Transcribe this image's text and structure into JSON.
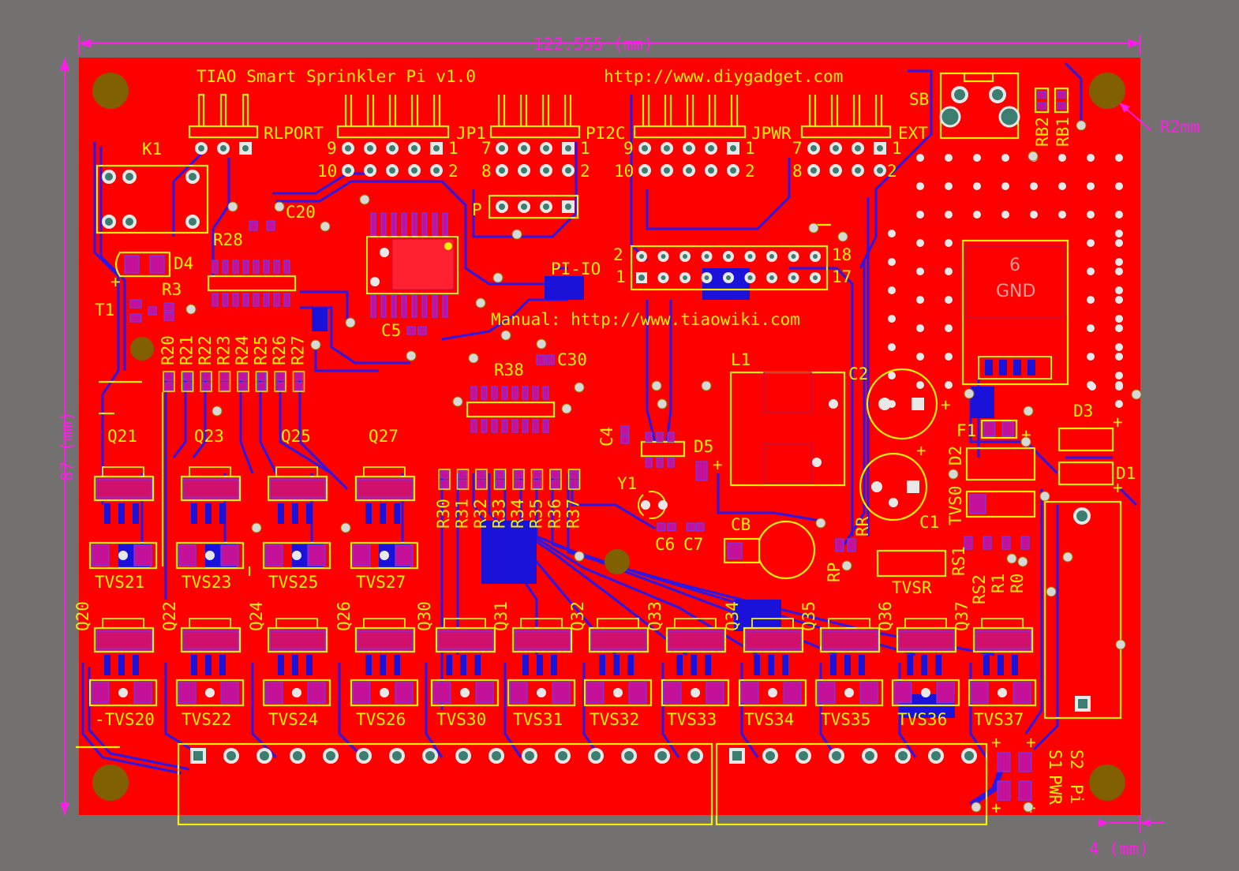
{
  "board": {
    "title": "TIAO Smart Sprinkler Pi v1.0",
    "url": "http://www.diygadget.com",
    "manual": "Manual: http://www.tiaowiki.com"
  },
  "dimensions": {
    "width_label": "122.555 (mm)",
    "height_label": "87 (mm)",
    "margin_label": "4 (mm)",
    "hole_label": "R2mm"
  },
  "connectors": {
    "rlport": "RLPORT",
    "jp1": "JP1",
    "pi2c": "PI2C",
    "jpwr": "JPWR",
    "ext": "EXT",
    "sb": "SB",
    "k1": "K1",
    "p": "P",
    "pi_io": "PI-IO",
    "pin_labels": {
      "jp1_left_top": "9",
      "jp1_right_top": "1",
      "jp1_left_bot": "10",
      "jp1_right_bot": "2",
      "pi2c_left_top": "7",
      "pi2c_right_top": "1",
      "pi2c_left_bot": "8",
      "pi2c_right_bot": "2",
      "jpwr_left_top": "9",
      "jpwr_right_top": "1",
      "jpwr_left_bot": "10",
      "jpwr_right_bot": "2",
      "ext_left_top": "7",
      "ext_right_top": "1",
      "ext_left_bot": "8",
      "ext_right_bot": "2",
      "piio_2": "2",
      "piio_1": "1",
      "piio_18": "18",
      "piio_17": "17"
    }
  },
  "components": {
    "c20": "C20",
    "r28": "R28",
    "d4": "D4",
    "r3": "R3",
    "t1": "T1",
    "c5": "C5",
    "c30": "C30",
    "r38": "R38",
    "c4": "C4",
    "d5": "D5",
    "y1": "Y1",
    "c6": "C6",
    "c7": "C7",
    "cb": "CB",
    "l1": "L1",
    "c2": "C2",
    "c1": "C1",
    "rr": "RR",
    "rp": "RP",
    "tvsr": "TVSR",
    "tvs0": "TVS0",
    "d2": "D2",
    "f1": "F1",
    "d3": "D3",
    "d1": "D1",
    "rs1": "RS1",
    "rs2": "RS2",
    "r1": "R1",
    "r0": "R0",
    "rb2": "RB2",
    "rb1": "RB1",
    "s1": "S1",
    "s2": "S2",
    "pwr": "PWR",
    "pi": "Pi",
    "gnd_block_top": "6",
    "gnd_block_bot": "GND"
  },
  "resistors_top": [
    "R20",
    "R21",
    "R22",
    "R23",
    "R24",
    "R25",
    "R26",
    "R27"
  ],
  "resistors_mid": [
    "R30",
    "R31",
    "R32",
    "R33",
    "R34",
    "R35",
    "R36",
    "R37"
  ],
  "q_top": [
    "Q21",
    "Q23",
    "Q25",
    "Q27"
  ],
  "tvs_top": [
    "TVS21",
    "TVS23",
    "TVS25",
    "TVS27"
  ],
  "q_bottom": [
    "Q20",
    "Q22",
    "Q24",
    "Q26",
    "Q30",
    "Q31",
    "Q32",
    "Q33",
    "Q34",
    "Q35",
    "Q36",
    "Q37"
  ],
  "tvs_bottom": [
    "-TVS20",
    "TVS22",
    "TVS24",
    "TVS26",
    "TVS30",
    "TVS31",
    "TVS32",
    "TVS33",
    "TVS34",
    "TVS35",
    "TVS36",
    "TVS37"
  ],
  "colors": {
    "background": "#727170",
    "board": "#ff0000",
    "silkscreen": "#f4f000",
    "bottom_copper": "#2a18e8",
    "dimension": "#ff1ee8",
    "pad": "#e8e8e8",
    "mount_hole": "#806000"
  }
}
